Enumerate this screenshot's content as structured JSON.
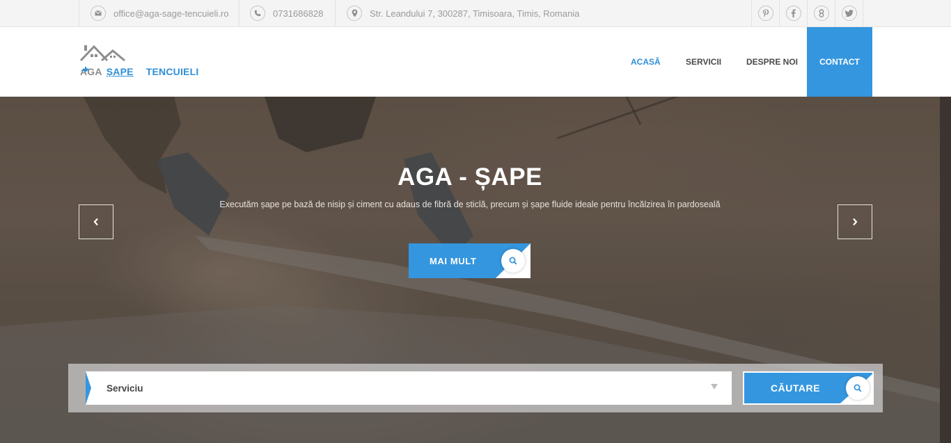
{
  "topbar": {
    "email": "office@aga-sage-tencuieli.ro",
    "phone": "0731686828",
    "address": "Str. Leandului 7, 300287, Timisoara, Timis, Romania",
    "social": [
      {
        "icon": "pinterest-icon",
        "glyph": "P"
      },
      {
        "icon": "facebook-icon",
        "glyph": "f"
      },
      {
        "icon": "google-plus-icon",
        "glyph": "g"
      },
      {
        "icon": "twitter-icon",
        "glyph": "t"
      }
    ]
  },
  "logo": {
    "word1": "AGA",
    "word2": "ȘAPE",
    "word3": "TENCUIELI"
  },
  "nav": {
    "home": "ACASĂ",
    "services": "SERVICII",
    "about": "DESPRE NOI",
    "contact": "CONTACT"
  },
  "hero": {
    "title": "AGA - ȘAPE",
    "subtitle": "Executăm șape pe bază de nisip și ciment cu adaus de fibră de sticlă, precum și șape fluide ideale pentru încălzirea în pardoseală",
    "button": "MAI MULT"
  },
  "search": {
    "select_value": "Serviciu",
    "button": "CĂUTARE"
  },
  "colors": {
    "accent": "#3496df",
    "topbar_bg": "#f4f4f4",
    "text_muted": "#9a9a9a"
  }
}
